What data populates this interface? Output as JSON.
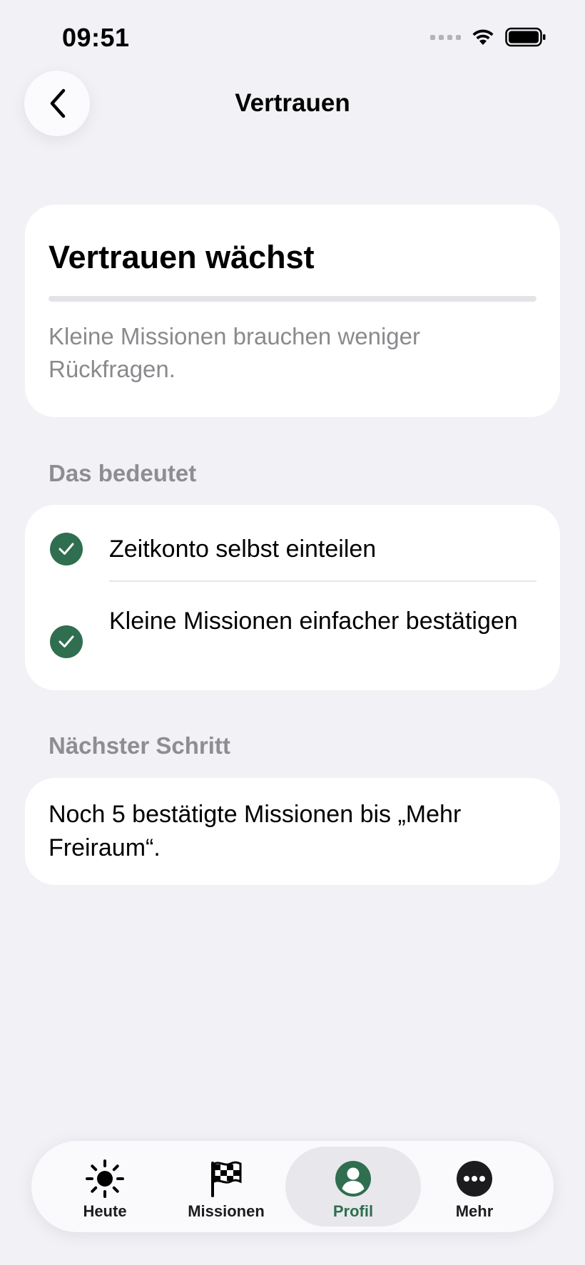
{
  "status_bar": {
    "time": "09:51"
  },
  "header": {
    "title": "Vertrauen",
    "back_icon": "chevron-left-icon"
  },
  "hero_card": {
    "title": "Vertrauen wächst",
    "progress_fraction": 0,
    "description": "Kleine Missionen brauchen weniger Rückfragen."
  },
  "meaning_section": {
    "label": "Das bedeutet",
    "items": [
      {
        "icon": "checkmark-circle-icon",
        "text": "Zeitkonto selbst einteilen"
      },
      {
        "icon": "checkmark-circle-icon",
        "text": "Kleine Missionen einfacher bestätigen"
      }
    ]
  },
  "next_step_section": {
    "label": "Nächster Schritt",
    "text": "Noch 5 bestätigte Missionen bis „Mehr Freiraum“."
  },
  "tab_bar": {
    "tabs": [
      {
        "label": "Heute",
        "icon": "sun-icon"
      },
      {
        "label": "Missionen",
        "icon": "checkered-flag-icon"
      },
      {
        "label": "Profil",
        "icon": "person-circle-icon",
        "selected": true
      },
      {
        "label": "Mehr",
        "icon": "more-ellipsis-icon"
      }
    ]
  },
  "colors": {
    "accent": "#2f6e4f",
    "background": "#f1f1f6",
    "card": "#ffffff",
    "secondary_text": "#8a8a8e"
  }
}
